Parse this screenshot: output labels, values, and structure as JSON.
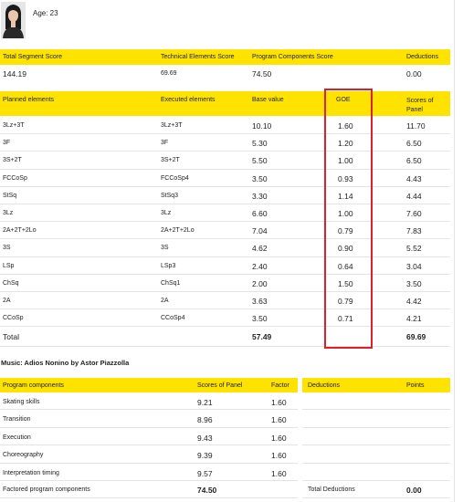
{
  "skater": {
    "age_label": "Age: 23"
  },
  "summary": {
    "headers": [
      "Total Segment Score",
      "Technical Elements Score",
      "Program Components Score",
      "Deductions"
    ],
    "values": [
      "144.19",
      "69.69",
      "74.50",
      "0.00"
    ]
  },
  "elements": {
    "headers": [
      "Planned elements",
      "Executed elements",
      "Base value",
      "GOE",
      "Scores of Panel"
    ],
    "rows": [
      [
        "3Lz+3T",
        "3Lz+3T",
        "10.10",
        "1.60",
        "11.70"
      ],
      [
        "3F",
        "3F",
        "5.30",
        "1.20",
        "6.50"
      ],
      [
        "3S+2T",
        "3S+2T",
        "5.50",
        "1.00",
        "6.50"
      ],
      [
        "FCCoSp",
        "FCCoSp4",
        "3.50",
        "0.93",
        "4.43"
      ],
      [
        "StSq",
        "StSq3",
        "3.30",
        "1.14",
        "4.44"
      ],
      [
        "3Lz",
        "3Lz",
        "6.60",
        "1.00",
        "7.60"
      ],
      [
        "2A+2T+2Lo",
        "2A+2T+2Lo",
        "7.04",
        "0.79",
        "7.83"
      ],
      [
        "3S",
        "3S",
        "4.62",
        "0.90",
        "5.52"
      ],
      [
        "LSp",
        "LSp3",
        "2.40",
        "0.64",
        "3.04"
      ],
      [
        "ChSq",
        "ChSq1",
        "2.00",
        "1.50",
        "3.50"
      ],
      [
        "2A",
        "2A",
        "3.63",
        "0.79",
        "4.42"
      ],
      [
        "CCoSp",
        "CCoSp4",
        "3.50",
        "0.71",
        "4.21"
      ]
    ],
    "total_label": "Total",
    "total_base": "57.49",
    "total_score": "69.69"
  },
  "music": "Music: Adios Nonino by Astor Piazzolla",
  "components": {
    "headers": [
      "Program components",
      "Scores of Panel",
      "Factor"
    ],
    "rows": [
      [
        "Skating skills",
        "9.21",
        "1.60"
      ],
      [
        "Transition",
        "8.96",
        "1.60"
      ],
      [
        "Execution",
        "9.43",
        "1.60"
      ],
      [
        "Choreography",
        "9.39",
        "1.60"
      ],
      [
        "Interpretation timing",
        "9.57",
        "1.60"
      ]
    ],
    "factored_label": "Factored program components",
    "factored_value": "74.50"
  },
  "deductions": {
    "headers": [
      "Deductions",
      "Points"
    ],
    "total_label": "Total Deductions",
    "total_value": "0.00"
  },
  "colors": {
    "header_bar": "#ffe300",
    "highlight_box": "#d8232a"
  }
}
